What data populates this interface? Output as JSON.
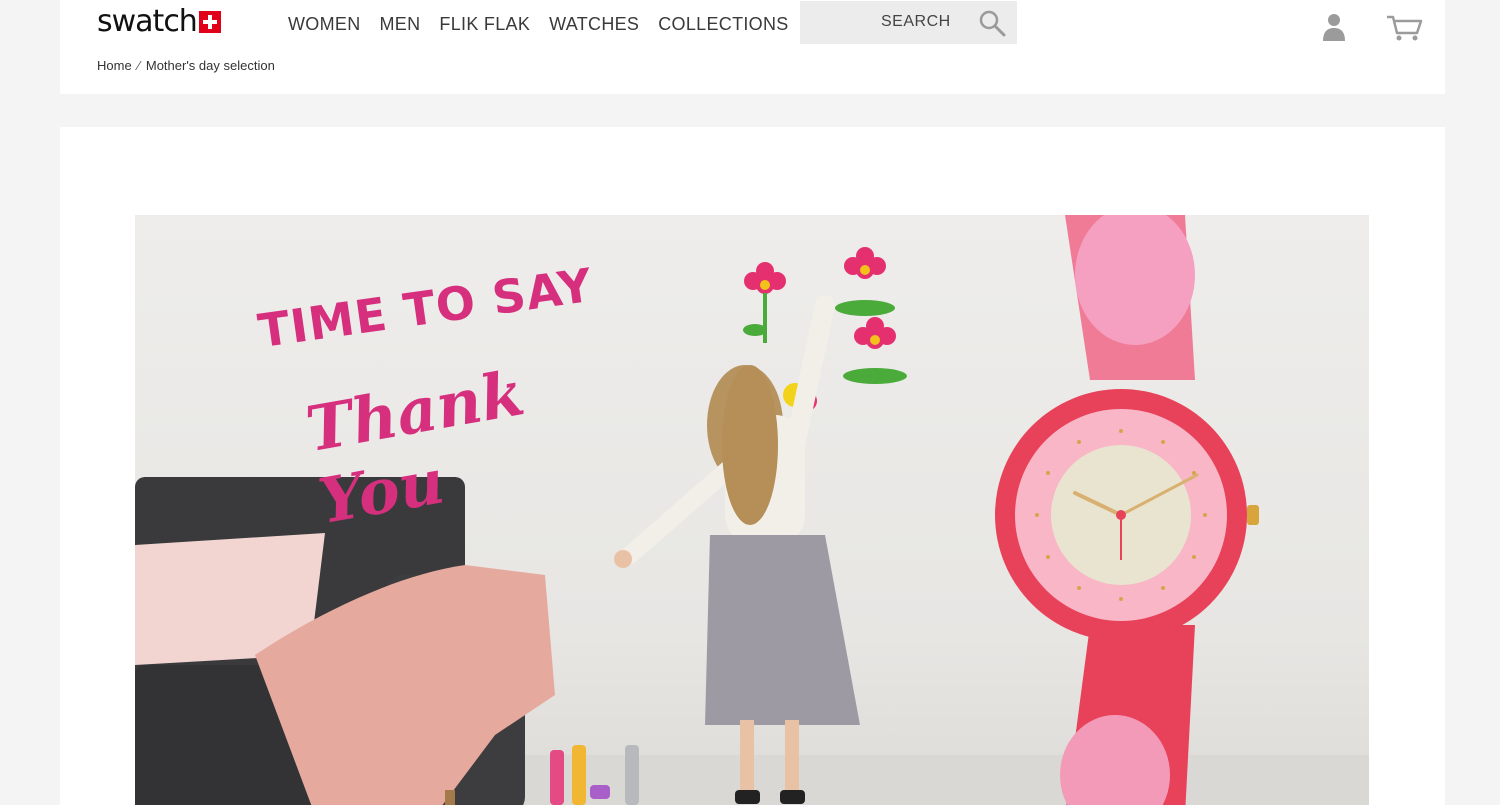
{
  "brand": {
    "name": "swatch"
  },
  "nav": {
    "items": [
      {
        "label": "WOMEN"
      },
      {
        "label": "MEN"
      },
      {
        "label": "FLIK FLAK"
      },
      {
        "label": "WATCHES"
      },
      {
        "label": "COLLECTIONS"
      }
    ]
  },
  "search": {
    "label": "SEARCH"
  },
  "icons": {
    "search": "search-icon",
    "user": "user-icon",
    "cart": "cart-icon"
  },
  "breadcrumb": {
    "home": "Home",
    "separator": "⁄",
    "current": "Mother's day selection"
  },
  "banner": {
    "headline_1": "TIME TO SAY",
    "headline_2": "Thank You"
  },
  "colors": {
    "accent_pink": "#d62f7e",
    "brand_red": "#e1001a",
    "watch_case": "#e8425a"
  }
}
